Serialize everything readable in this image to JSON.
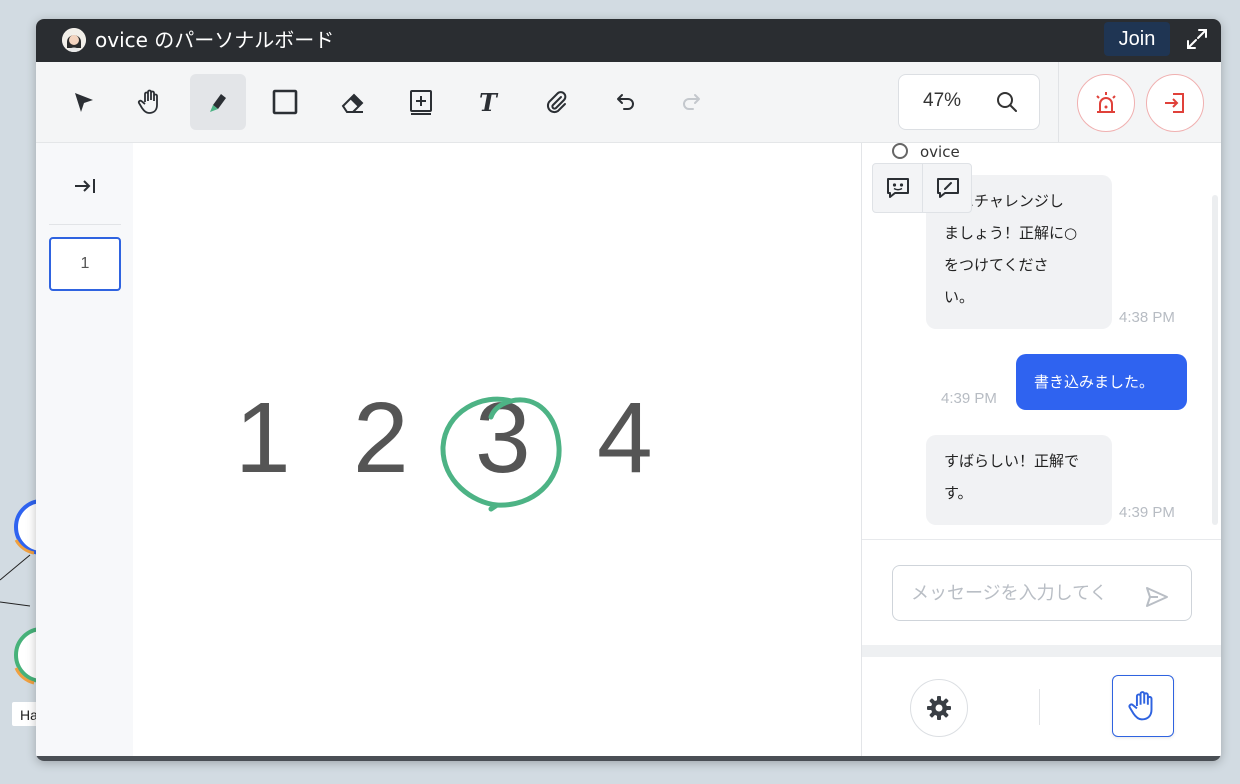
{
  "window": {
    "title": "ovice のパーソナルボード",
    "join_label": "Join",
    "avatar_icon": "user-avatar",
    "expand_icon": "expand-icon"
  },
  "toolbar": {
    "tools": [
      {
        "name": "select",
        "icon": "cursor-arrow-icon"
      },
      {
        "name": "pan",
        "icon": "hand-icon"
      },
      {
        "name": "marker",
        "icon": "marker-icon",
        "active": true
      },
      {
        "name": "rectangle",
        "icon": "square-icon"
      },
      {
        "name": "eraser",
        "icon": "eraser-icon"
      },
      {
        "name": "add-frame",
        "icon": "add-box-icon"
      },
      {
        "name": "text",
        "icon": "text-icon"
      },
      {
        "name": "attach",
        "icon": "paperclip-icon"
      },
      {
        "name": "undo",
        "icon": "undo-icon"
      },
      {
        "name": "redo",
        "icon": "redo-icon"
      }
    ],
    "zoom": "47%",
    "alarm_icon": "alarm-icon",
    "exit_icon": "exit-icon"
  },
  "pages": {
    "items": [
      "1"
    ],
    "current": "1"
  },
  "canvas": {
    "numbers": [
      "1",
      "2",
      "3",
      "4"
    ],
    "circled": "3",
    "ink_color": "#4db385"
  },
  "chat": {
    "user_name": "ovice",
    "messages": [
      {
        "from": "other",
        "lines": [
          "問にチャレンジし",
          "ましょう！正解に○",
          "をつけてくださ",
          "い。"
        ],
        "time": "4:38 PM"
      },
      {
        "from": "me",
        "lines": [
          "書き込みました。"
        ],
        "time": "4:39 PM"
      },
      {
        "from": "other",
        "lines": [
          "すばらしい！正解で",
          "す。"
        ],
        "time": "4:39 PM"
      }
    ],
    "input_placeholder": "メッセージを入力してく",
    "accent": "#2f63f0"
  }
}
